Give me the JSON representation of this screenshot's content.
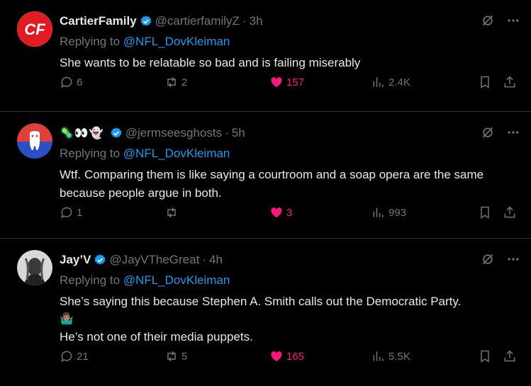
{
  "tweets": [
    {
      "name": "CartierFamily",
      "handle": "@cartierfamilyZ",
      "time": "3h",
      "replying_prefix": "Replying to",
      "mention": "@NFL_DovKleiman",
      "text": "She wants to be relatable so bad and is failing miserably",
      "replies": "6",
      "reposts": "2",
      "likes": "157",
      "views": "2.4K",
      "avatar_text": "CF"
    },
    {
      "name_emojis": "🦠👀👻",
      "handle": "@jermseesghosts",
      "time": "5h",
      "replying_prefix": "Replying to",
      "mention": "@NFL_DovKleiman",
      "text": "Wtf. Comparing them is like saying a courtroom and a soap opera are the same because people argue in both.",
      "replies": "1",
      "reposts": "",
      "likes": "3",
      "views": "993"
    },
    {
      "name": "Jay’V",
      "handle": "@JayVTheGreat",
      "time": "4h",
      "replying_prefix": "Replying to",
      "mention": "@NFL_DovKleiman",
      "text": "She’s saying this because Stephen A. Smith calls out the Democratic Party.",
      "emoji": "🤷🏽‍♂️",
      "text2": "He’s not one of their media puppets.",
      "replies": "21",
      "reposts": "5",
      "likes": "165",
      "views": "5.5K"
    }
  ],
  "colors": {
    "accent": "#1d9bf0",
    "like": "#f91880",
    "muted": "#71767b"
  }
}
